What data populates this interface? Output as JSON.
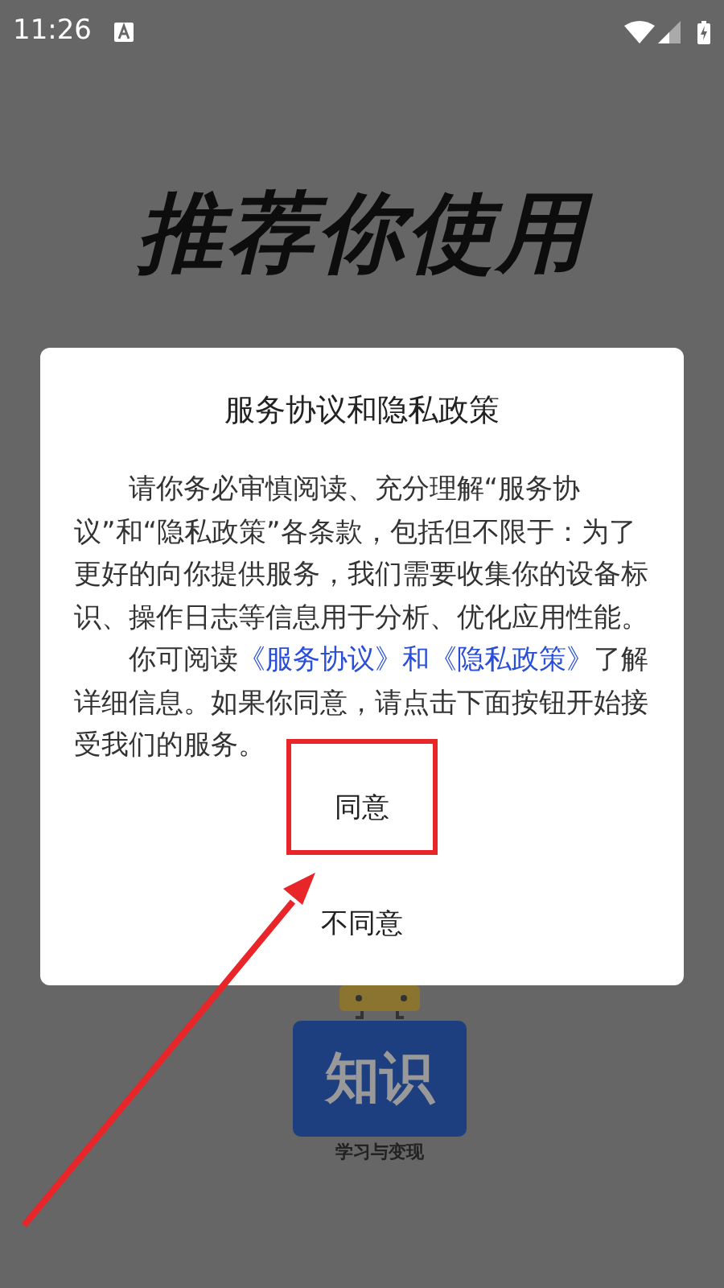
{
  "status_bar": {
    "time": "11:26"
  },
  "background": {
    "headline": "推荐你使用",
    "logo_text": "知识",
    "slogan": "学习与变现"
  },
  "dialog": {
    "title": "服务协议和隐私政策",
    "paragraph_1": "请你务必审慎阅读、充分理解“服务协议”和“隐私政策”各条款，包括但不限于：为了更好的向你提供服务，我们需要收集你的设备标识、操作日志等信息用于分析、优化应用性能。",
    "paragraph_2_before": "你可阅读",
    "paragraph_2_link": "《服务协议》和《隐私政策》",
    "paragraph_2_after": "了解详细信息。如果你同意，请点击下面按钮开始接受我们的服务。",
    "buttons": [
      {
        "label": "同意",
        "highlighted": true
      },
      {
        "label": "不同意",
        "highlighted": false
      }
    ]
  }
}
